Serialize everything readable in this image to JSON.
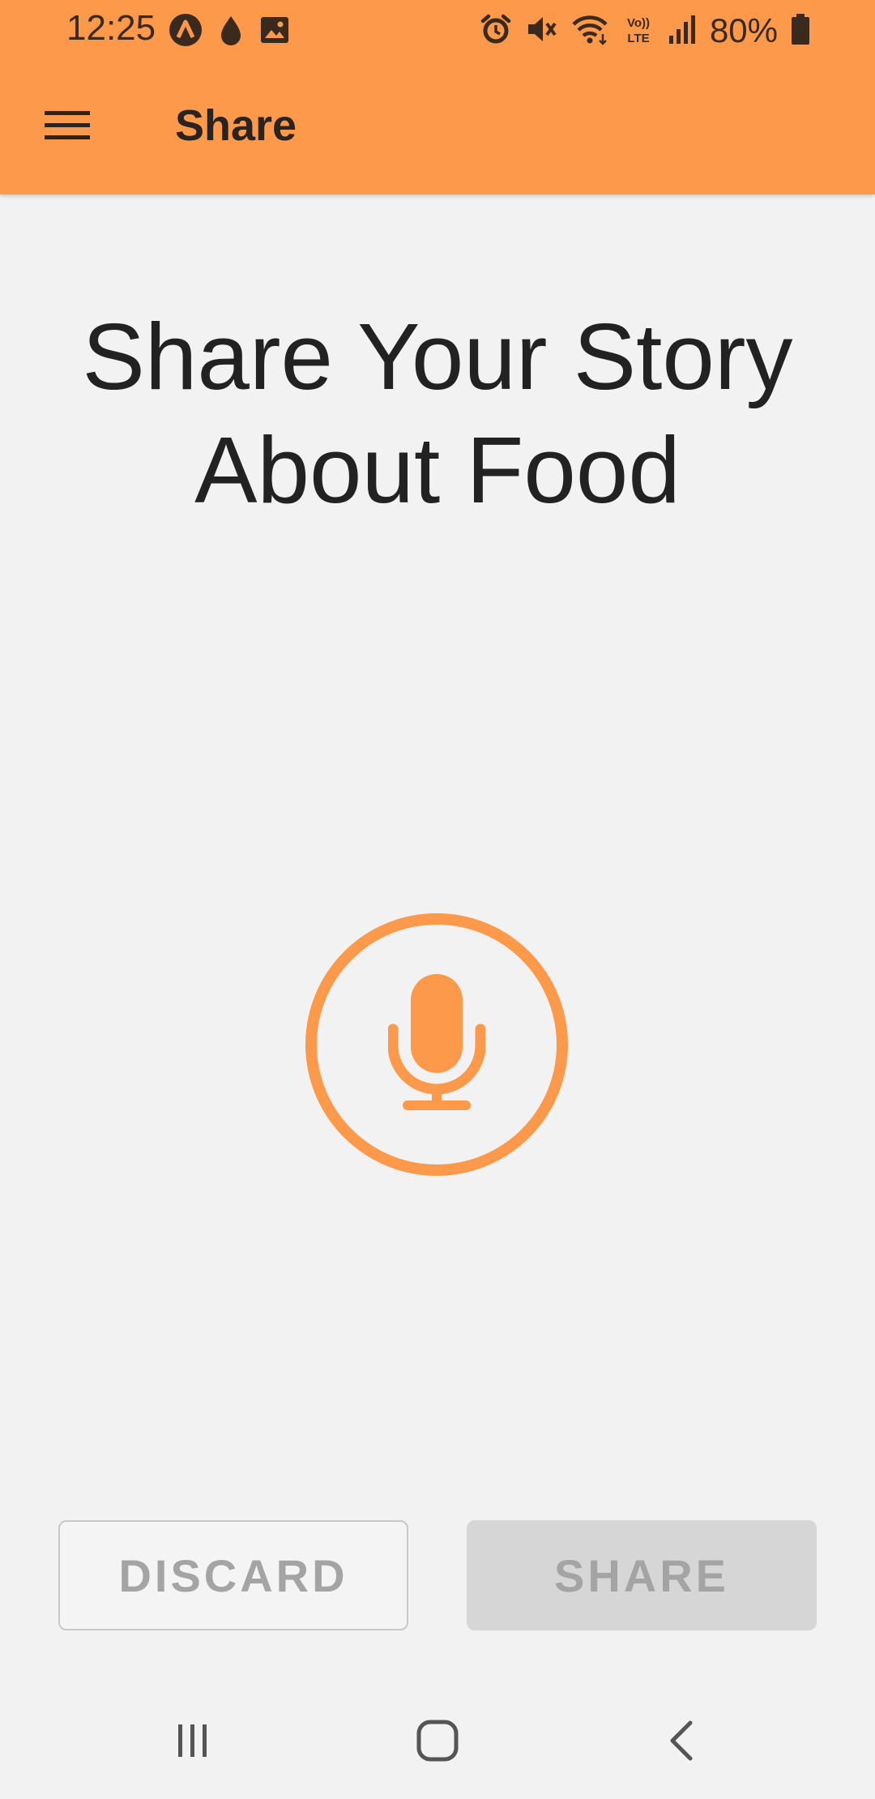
{
  "status_bar": {
    "time": "12:25",
    "battery_percent": "80%",
    "left_icons": [
      "app-notification-icon",
      "drop-icon",
      "image-icon"
    ],
    "right_icons": [
      "alarm-icon",
      "mute-icon",
      "wifi-icon",
      "volte-icon",
      "signal-icon",
      "battery-icon"
    ]
  },
  "app_bar": {
    "title": "Share",
    "menu_icon": "hamburger-menu-icon"
  },
  "main": {
    "headline_line1": "Share Your Story",
    "headline_line2": "About Food",
    "mic_icon": "microphone-icon"
  },
  "actions": {
    "discard_label": "DISCARD",
    "share_label": "SHARE"
  },
  "nav_bar": {
    "items": [
      "recent-apps-icon",
      "home-icon",
      "back-icon"
    ]
  },
  "colors": {
    "accent": "#fd994b",
    "background": "#f2f2f2",
    "text_dark": "#222222",
    "disabled_text": "#a4a4a4"
  }
}
